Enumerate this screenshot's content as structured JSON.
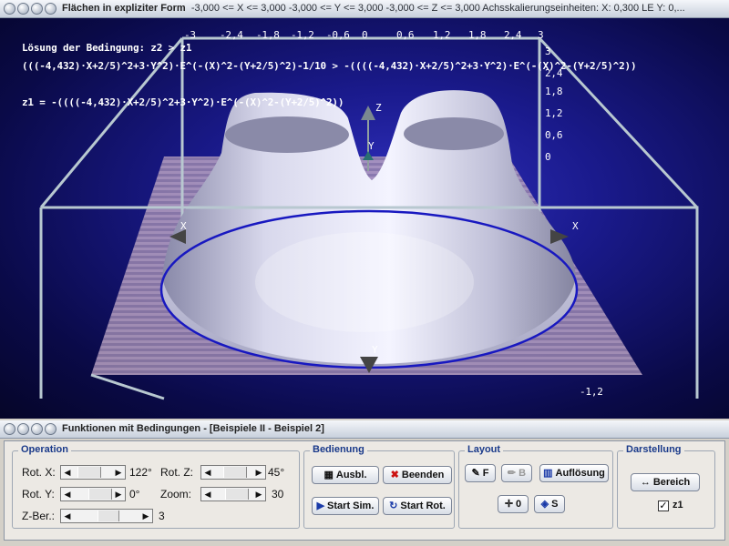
{
  "top_window": {
    "title_main": "Flächen in expliziter Form",
    "title_ranges": "-3,000 <= X <= 3,000  -3,000 <= Y <= 3,000  -3,000 <= Z <= 3,000  Achsskalierungseinheiten:  X: 0,300 LE   Y: 0,..."
  },
  "plot": {
    "top_axis_ticks": [
      "-3",
      "-2,4",
      "-1,8",
      "-1,2",
      "-0,6",
      "0",
      "0,6",
      "1,2",
      "1,8",
      "2,4",
      "3"
    ],
    "right_axis_ticks": [
      "3",
      "2,4",
      "1,8",
      "1,2",
      "0,6",
      "0"
    ],
    "bottom_tick": "-1,2",
    "axis_labels": {
      "z": "Z",
      "y_top": "Y",
      "x_left": "X",
      "x_right": "X",
      "y_bottom": "Y"
    },
    "equations": {
      "line1": "Lösung der Bedingung: z2 > z1",
      "line2": "(((-4,432)·X+2/5)^2+3·Y^2)·E^(-(X)^2-(Y+2/5)^2)-1/10 > -((((-4,432)·X+2/5)^2+3·Y^2)·E^(-(X)^2-(Y+2/5)^2))",
      "line3": "z1 = -((((-4,432)·X+2/5)^2+3·Y^2)·E^(-(X)^2-(Y+2/5)^2))"
    },
    "colors": {
      "background": "#101070",
      "surface": "#c8c8e0",
      "box": "#b8c8d0",
      "plane": "#b0a0c0",
      "curve": "#1818c0"
    }
  },
  "bottom_window": {
    "title": "Funktionen mit Bedingungen - [Beispiele II - Beispiel 2]"
  },
  "operation": {
    "title": "Operation",
    "rot_x_label": "Rot. X:",
    "rot_x_value": "122°",
    "rot_y_label": "Rot. Y:",
    "rot_y_value": "0°",
    "z_ber_label": "Z-Ber.:",
    "z_ber_value": "3",
    "rot_z_label": "Rot. Z:",
    "rot_z_value": "45°",
    "zoom_label": "Zoom:",
    "zoom_value": "30"
  },
  "bedienung": {
    "title": "Bedienung",
    "ausbl": "Ausbl.",
    "beenden": "Beenden",
    "start_sim": "Start Sim.",
    "start_rot": "Start Rot."
  },
  "layout": {
    "title": "Layout",
    "f_btn": "F",
    "b_btn": "B",
    "aufloesung": "Auflösung",
    "o_btn": "0",
    "s_btn": "S"
  },
  "darstellung": {
    "title": "Darstellung",
    "bereich": "Bereich",
    "z1_label": "z1",
    "z1_checked": true
  }
}
